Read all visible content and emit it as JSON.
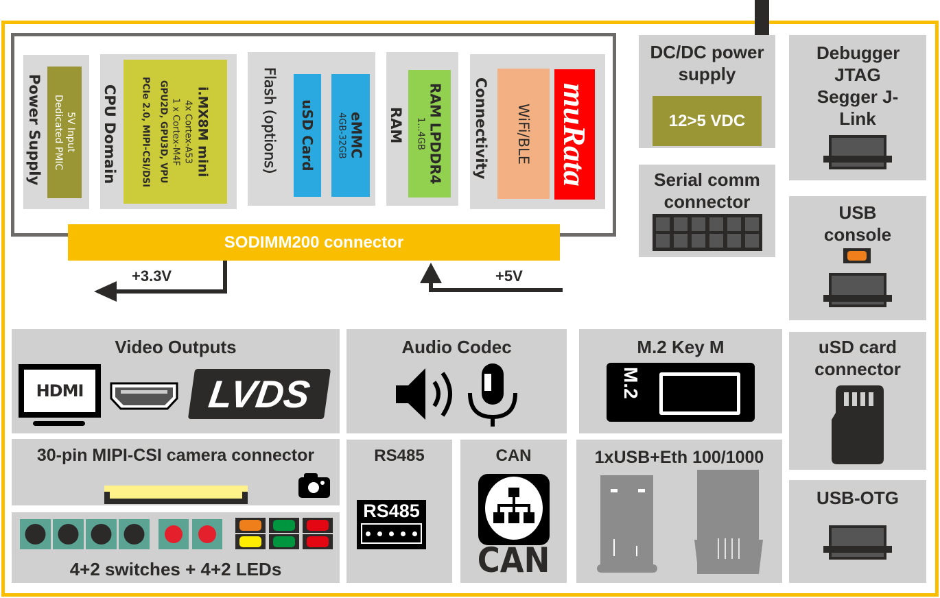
{
  "som": {
    "power_supply": {
      "label": "Power Supply",
      "inner": [
        "5V Input",
        "Dedicated PMIC"
      ]
    },
    "cpu": {
      "label": "CPU Domain",
      "chip": "i.MX8M mini",
      "lines": [
        "4x Cortex-A53",
        "1 x Cortex-M4F"
      ],
      "features": [
        "GPU2D, GPU3D, VPU",
        "PCIe 2.0, MIPI-CSI/DSI"
      ]
    },
    "flash": {
      "label": "Flash (options)",
      "usd": "uSD Card",
      "emmc": "eMMC",
      "emmc_size": "4GB-32GB"
    },
    "ram": {
      "label": "RAM",
      "chip": "RAM LPDDR4",
      "size": "1...4GB"
    },
    "connectivity": {
      "label": "Connectivity",
      "wifi": "WiFi/BLE",
      "brand": "muRata"
    }
  },
  "sodimm": "SODIMM200 connector",
  "rails": {
    "out": "+3.3V",
    "in": "+5V"
  },
  "dcdc": {
    "title": "DC/DC power supply",
    "value": "12>5 VDC"
  },
  "serial": {
    "title": "Serial comm connector"
  },
  "debugger": {
    "title": "Debugger JTAG Segger J-Link"
  },
  "usb_console": {
    "title": "USB console"
  },
  "usd_connector": {
    "title": "uSD card connector"
  },
  "usb_otg": {
    "title": "USB-OTG"
  },
  "video": {
    "title": "Video Outputs",
    "hdmi": "HDMI",
    "lvds": "LVDS"
  },
  "audio": {
    "title": "Audio Codec"
  },
  "m2": {
    "title": "M.2 Key M",
    "badge": "M.2"
  },
  "camera": {
    "title": "30-pin MIPI-CSI camera connector"
  },
  "switches": {
    "title": "4+2 switches + 4+2 LEDs",
    "led_colors": [
      "#ef7f1a",
      "#ffed00",
      "#009640",
      "#009640",
      "#e30613",
      "#e30613"
    ]
  },
  "rs485": {
    "title": "RS485",
    "badge": "RS485"
  },
  "can": {
    "title": "CAN",
    "badge": "CAN"
  },
  "usb_eth": {
    "title": "1xUSB+Eth 100/1000"
  },
  "colors": {
    "accent": "#f9be00",
    "panel": "#cfd0cf",
    "cpu": "#cccc3a",
    "pmic": "#9a9535",
    "flash": "#29a9e0",
    "ram": "#92d050",
    "wifi": "#f3b183",
    "murata": "#ff0000"
  }
}
